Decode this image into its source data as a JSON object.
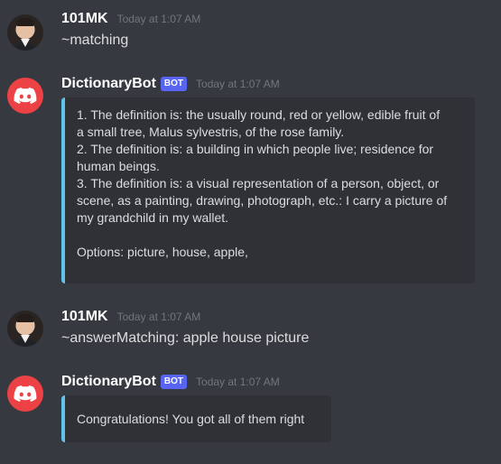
{
  "messages": [
    {
      "author": "101MK",
      "timestamp": "Today at 1:07 AM",
      "content": "~matching"
    },
    {
      "author": "DictionaryBot",
      "badge": "BOT",
      "timestamp": "Today at 1:07 AM",
      "embed_lines": [
        "1. The definition is: the usually round, red or yellow, edible fruit of",
        "a small tree, Malus sylvestris, of the rose family.",
        "2. The definition is: a building in which people live; residence for",
        "human beings.",
        "3. The definition is: a visual representation of a person, object, or",
        "scene, as a painting, drawing, photograph, etc.: I carry a picture of",
        "my grandchild in my wallet.",
        "",
        "Options: picture, house, apple,"
      ]
    },
    {
      "author": "101MK",
      "timestamp": "Today at 1:07 AM",
      "content": "~answerMatching: apple house picture"
    },
    {
      "author": "DictionaryBot",
      "badge": "BOT",
      "timestamp": "Today at 1:07 AM",
      "embed_lines": [
        "Congratulations! You got all of them right"
      ]
    }
  ],
  "colors": {
    "background": "#36393f",
    "embed_background": "#2f3136",
    "embed_accent": "#5ec4ea",
    "bot_badge": "#5865f2",
    "bot_avatar": "#ed4245"
  }
}
